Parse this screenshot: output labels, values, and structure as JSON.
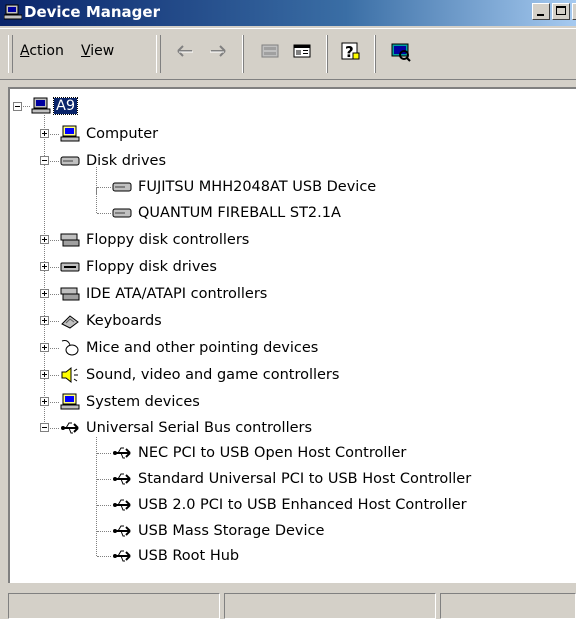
{
  "window": {
    "title": "Device Manager"
  },
  "menu": {
    "action": {
      "accel": "A",
      "rest": "ction"
    },
    "view": {
      "accel": "V",
      "rest": "iew"
    }
  },
  "toolbar_icons": [
    "back-arrow-icon",
    "forward-arrow-icon",
    "properties-icon",
    "view-icon",
    "help-icon",
    "scan-hardware-icon"
  ],
  "tree": {
    "root": "A9",
    "nodes": [
      {
        "label": "Computer",
        "icon": "computer-icon",
        "state": "collapsed"
      },
      {
        "label": "Disk drives",
        "icon": "disk-drive-icon",
        "state": "expanded",
        "children": [
          {
            "label": "FUJITSU MHH2048AT USB Device",
            "icon": "disk-drive-icon"
          },
          {
            "label": "QUANTUM FIREBALL ST2.1A",
            "icon": "disk-drive-icon"
          }
        ]
      },
      {
        "label": "Floppy disk controllers",
        "icon": "controller-icon",
        "state": "collapsed"
      },
      {
        "label": "Floppy disk drives",
        "icon": "floppy-drive-icon",
        "state": "collapsed"
      },
      {
        "label": "IDE ATA/ATAPI controllers",
        "icon": "controller-icon",
        "state": "collapsed"
      },
      {
        "label": "Keyboards",
        "icon": "keyboard-icon",
        "state": "collapsed"
      },
      {
        "label": "Mice and other pointing devices",
        "icon": "mouse-icon",
        "state": "collapsed"
      },
      {
        "label": "Sound, video and game controllers",
        "icon": "speaker-icon",
        "state": "collapsed"
      },
      {
        "label": "System devices",
        "icon": "computer-icon",
        "state": "collapsed"
      },
      {
        "label": "Universal Serial Bus controllers",
        "icon": "usb-icon",
        "state": "expanded",
        "children": [
          {
            "label": "NEC PCI to USB Open Host Controller",
            "icon": "usb-icon"
          },
          {
            "label": "Standard Universal PCI to USB Host Controller",
            "icon": "usb-icon"
          },
          {
            "label": "USB 2.0 PCI to USB Enhanced Host Controller",
            "icon": "usb-icon"
          },
          {
            "label": "USB Mass Storage Device",
            "icon": "usb-icon"
          },
          {
            "label": "USB Root Hub",
            "icon": "usb-icon"
          }
        ]
      }
    ]
  },
  "colors": {
    "titlebar": "#0a246a",
    "chrome": "#d4d0c8",
    "selection": "#0a246a"
  },
  "statusbar": {
    "panes": [
      "",
      "",
      ""
    ]
  }
}
